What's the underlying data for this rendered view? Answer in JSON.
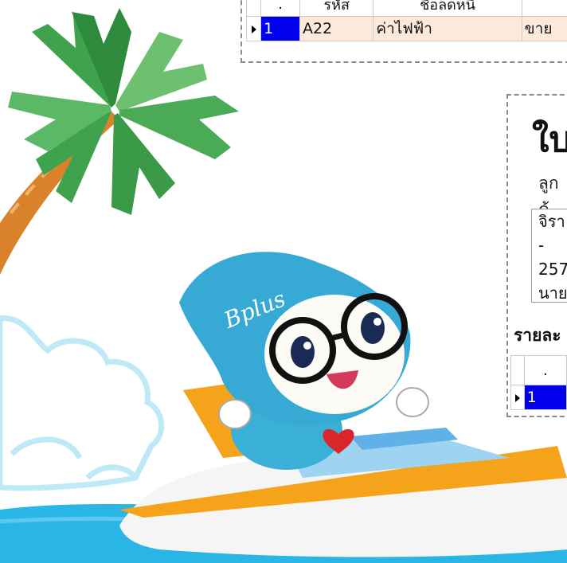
{
  "top_grid": {
    "headers": [
      ".",
      "รหัส",
      "ชื่อลดหนี้",
      ""
    ],
    "rows": [
      {
        "no": "1",
        "code": "A22",
        "name": "ค่าไฟฟ้า",
        "type": "ขาย"
      }
    ]
  },
  "document": {
    "title": "ใบ",
    "customer_label": "ลูกค้",
    "address_lines": [
      "จิรา",
      "-",
      "257",
      "นาย"
    ]
  },
  "detail": {
    "label": "รายละ",
    "headers": [
      "."
    ],
    "rows": [
      {
        "no": "1"
      }
    ]
  },
  "illustration": {
    "cap_text": "Bplus"
  },
  "colors": {
    "selected_row": "#fde9d9",
    "selected_cell": "#0000ee",
    "panel_border": "#8c8c8c"
  }
}
